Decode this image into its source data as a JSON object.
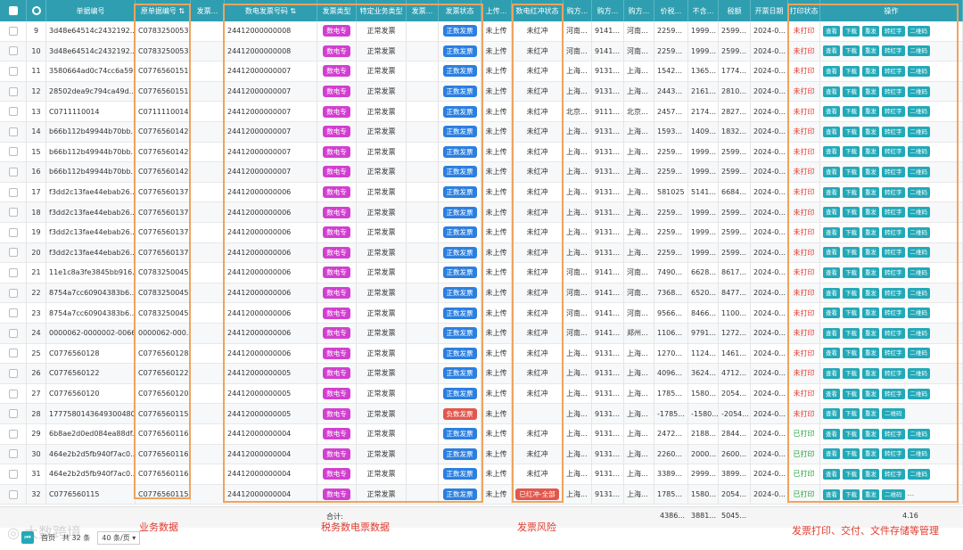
{
  "columns": {
    "row_no": "",
    "bill_no": "单据编号",
    "src_bill_no": "原单据编号",
    "issuer": "发票...",
    "invoice_no": "数电发票号码",
    "invoice_type": "发票类型",
    "biz_type": "特定业务类型",
    "invoice_x": "发票...",
    "invoice_status": "发票状态",
    "upload": "上传...",
    "red_status": "数电红冲状态",
    "buyer1": "购方...",
    "buyer2": "购方...",
    "buyer3": "购方...",
    "total": "价税...",
    "excl": "不含...",
    "tax": "税额",
    "date": "开票日期",
    "print_status": "打印状态",
    "ops": "操作"
  },
  "op_labels": {
    "view": "查看",
    "download": "下载",
    "resend": "重发",
    "to_red": "转红字",
    "qrcode": "二维码",
    "more": "..."
  },
  "rows": [
    {
      "n": "9",
      "bill": "3d48e64514c2432192...",
      "src": "C0783250053",
      "inv": "24412000000008",
      "itype": "数电专",
      "biz": "正常发票",
      "status": "正数发票",
      "stype": "blue",
      "upload": "未上传",
      "red": "未红冲",
      "rtype": "",
      "b1": "河南...",
      "b2": "9141...",
      "b3": "河南...",
      "total": "2259...",
      "excl": "1999...",
      "tax": "2599...",
      "date": "2024-0...",
      "print": "未打印",
      "ptype": "red",
      "ops": [
        "view",
        "download",
        "resend",
        "to_red",
        "qrcode"
      ]
    },
    {
      "n": "10",
      "bill": "3d48e64514c2432192...",
      "src": "C0783250053",
      "inv": "24412000000008",
      "itype": "数电专",
      "biz": "正常发票",
      "status": "正数发票",
      "stype": "blue",
      "upload": "未上传",
      "red": "未红冲",
      "rtype": "",
      "b1": "河南...",
      "b2": "9141...",
      "b3": "河南...",
      "total": "2259...",
      "excl": "1999...",
      "tax": "2599...",
      "date": "2024-0...",
      "print": "未打印",
      "ptype": "red",
      "ops": [
        "view",
        "download",
        "resend",
        "to_red",
        "qrcode"
      ]
    },
    {
      "n": "11",
      "bill": "3580664ad0c74cc6a59...",
      "src": "C0776560151",
      "inv": "24412000000007",
      "itype": "数电专",
      "biz": "正常发票",
      "status": "正数发票",
      "stype": "blue",
      "upload": "未上传",
      "red": "未红冲",
      "rtype": "",
      "b1": "上海...",
      "b2": "9131...",
      "b3": "上海...",
      "total": "1542...",
      "excl": "1365...",
      "tax": "1774...",
      "date": "2024-0...",
      "print": "未打印",
      "ptype": "red",
      "ops": [
        "view",
        "download",
        "resend",
        "to_red",
        "qrcode"
      ]
    },
    {
      "n": "12",
      "bill": "28502dea9c794ca49d...",
      "src": "C0776560151",
      "inv": "24412000000007",
      "itype": "数电专",
      "biz": "正常发票",
      "status": "正数发票",
      "stype": "blue",
      "upload": "未上传",
      "red": "未红冲",
      "rtype": "",
      "b1": "上海...",
      "b2": "9131...",
      "b3": "上海...",
      "total": "2443...",
      "excl": "2161...",
      "tax": "2810...",
      "date": "2024-0...",
      "print": "未打印",
      "ptype": "red",
      "ops": [
        "view",
        "download",
        "resend",
        "to_red",
        "qrcode"
      ]
    },
    {
      "n": "13",
      "bill": "C0711110014",
      "src": "C0711110014",
      "inv": "24412000000007",
      "itype": "数电专",
      "biz": "正常发票",
      "status": "正数发票",
      "stype": "blue",
      "upload": "未上传",
      "red": "未红冲",
      "rtype": "",
      "b1": "北京...",
      "b2": "9111...",
      "b3": "北京...",
      "total": "2457...",
      "excl": "2174...",
      "tax": "2827...",
      "date": "2024-0...",
      "print": "未打印",
      "ptype": "red",
      "ops": [
        "view",
        "download",
        "resend",
        "to_red",
        "qrcode"
      ]
    },
    {
      "n": "14",
      "bill": "b66b112b49944b70bb...",
      "src": "C0776560142",
      "inv": "24412000000007",
      "itype": "数电专",
      "biz": "正常发票",
      "status": "正数发票",
      "stype": "blue",
      "upload": "未上传",
      "red": "未红冲",
      "rtype": "",
      "b1": "上海...",
      "b2": "9131...",
      "b3": "上海...",
      "total": "1593...",
      "excl": "1409...",
      "tax": "1832...",
      "date": "2024-0...",
      "print": "未打印",
      "ptype": "red",
      "ops": [
        "view",
        "download",
        "resend",
        "to_red",
        "qrcode"
      ]
    },
    {
      "n": "15",
      "bill": "b66b112b49944b70bb...",
      "src": "C0776560142",
      "inv": "24412000000007",
      "itype": "数电专",
      "biz": "正常发票",
      "status": "正数发票",
      "stype": "blue",
      "upload": "未上传",
      "red": "未红冲",
      "rtype": "",
      "b1": "上海...",
      "b2": "9131...",
      "b3": "上海...",
      "total": "2259...",
      "excl": "1999...",
      "tax": "2599...",
      "date": "2024-0...",
      "print": "未打印",
      "ptype": "red",
      "ops": [
        "view",
        "download",
        "resend",
        "to_red",
        "qrcode"
      ]
    },
    {
      "n": "16",
      "bill": "b66b112b49944b70bb...",
      "src": "C0776560142",
      "inv": "24412000000007",
      "itype": "数电专",
      "biz": "正常发票",
      "status": "正数发票",
      "stype": "blue",
      "upload": "未上传",
      "red": "未红冲",
      "rtype": "",
      "b1": "上海...",
      "b2": "9131...",
      "b3": "上海...",
      "total": "2259...",
      "excl": "1999...",
      "tax": "2599...",
      "date": "2024-0...",
      "print": "未打印",
      "ptype": "red",
      "ops": [
        "view",
        "download",
        "resend",
        "to_red",
        "qrcode"
      ]
    },
    {
      "n": "17",
      "bill": "f3dd2c13fae44ebab26...",
      "src": "C0776560137",
      "inv": "24412000000006",
      "itype": "数电专",
      "biz": "正常发票",
      "status": "正数发票",
      "stype": "blue",
      "upload": "未上传",
      "red": "未红冲",
      "rtype": "",
      "b1": "上海...",
      "b2": "9131...",
      "b3": "上海...",
      "total": "581025",
      "excl": "5141...",
      "tax": "6684...",
      "date": "2024-0...",
      "print": "未打印",
      "ptype": "red",
      "ops": [
        "view",
        "download",
        "resend",
        "to_red",
        "qrcode"
      ]
    },
    {
      "n": "18",
      "bill": "f3dd2c13fae44ebab26...",
      "src": "C0776560137",
      "inv": "24412000000006",
      "itype": "数电专",
      "biz": "正常发票",
      "status": "正数发票",
      "stype": "blue",
      "upload": "未上传",
      "red": "未红冲",
      "rtype": "",
      "b1": "上海...",
      "b2": "9131...",
      "b3": "上海...",
      "total": "2259...",
      "excl": "1999...",
      "tax": "2599...",
      "date": "2024-0...",
      "print": "未打印",
      "ptype": "red",
      "ops": [
        "view",
        "download",
        "resend",
        "to_red",
        "qrcode"
      ]
    },
    {
      "n": "19",
      "bill": "f3dd2c13fae44ebab26...",
      "src": "C0776560137",
      "inv": "24412000000006",
      "itype": "数电专",
      "biz": "正常发票",
      "status": "正数发票",
      "stype": "blue",
      "upload": "未上传",
      "red": "未红冲",
      "rtype": "",
      "b1": "上海...",
      "b2": "9131...",
      "b3": "上海...",
      "total": "2259...",
      "excl": "1999...",
      "tax": "2599...",
      "date": "2024-0...",
      "print": "未打印",
      "ptype": "red",
      "ops": [
        "view",
        "download",
        "resend",
        "to_red",
        "qrcode"
      ]
    },
    {
      "n": "20",
      "bill": "f3dd2c13fae44ebab26...",
      "src": "C0776560137",
      "inv": "24412000000006",
      "itype": "数电专",
      "biz": "正常发票",
      "status": "正数发票",
      "stype": "blue",
      "upload": "未上传",
      "red": "未红冲",
      "rtype": "",
      "b1": "上海...",
      "b2": "9131...",
      "b3": "上海...",
      "total": "2259...",
      "excl": "1999...",
      "tax": "2599...",
      "date": "2024-0...",
      "print": "未打印",
      "ptype": "red",
      "ops": [
        "view",
        "download",
        "resend",
        "to_red",
        "qrcode"
      ]
    },
    {
      "n": "21",
      "bill": "11e1c8a3fe3845bb916...",
      "src": "C0783250045",
      "inv": "24412000000006",
      "itype": "数电专",
      "biz": "正常发票",
      "status": "正数发票",
      "stype": "blue",
      "upload": "未上传",
      "red": "未红冲",
      "rtype": "",
      "b1": "河南...",
      "b2": "9141...",
      "b3": "河南...",
      "total": "7490...",
      "excl": "6628...",
      "tax": "8617...",
      "date": "2024-0...",
      "print": "未打印",
      "ptype": "red",
      "ops": [
        "view",
        "download",
        "resend",
        "to_red",
        "qrcode"
      ]
    },
    {
      "n": "22",
      "bill": "8754a7cc60904383b6...",
      "src": "C0783250045",
      "inv": "24412000000006",
      "itype": "数电专",
      "biz": "正常发票",
      "status": "正数发票",
      "stype": "blue",
      "upload": "未上传",
      "red": "未红冲",
      "rtype": "",
      "b1": "河南...",
      "b2": "9141...",
      "b3": "河南...",
      "total": "7368...",
      "excl": "6520...",
      "tax": "8477...",
      "date": "2024-0...",
      "print": "未打印",
      "ptype": "red",
      "ops": [
        "view",
        "download",
        "resend",
        "to_red",
        "qrcode"
      ]
    },
    {
      "n": "23",
      "bill": "8754a7cc60904383b6...",
      "src": "C0783250045",
      "inv": "24412000000006",
      "itype": "数电专",
      "biz": "正常发票",
      "status": "正数发票",
      "stype": "blue",
      "upload": "未上传",
      "red": "未红冲",
      "rtype": "",
      "b1": "河南...",
      "b2": "9141...",
      "b3": "河南...",
      "total": "9566...",
      "excl": "8466...",
      "tax": "1100...",
      "date": "2024-0...",
      "print": "未打印",
      "ptype": "red",
      "ops": [
        "view",
        "download",
        "resend",
        "to_red",
        "qrcode"
      ]
    },
    {
      "n": "24",
      "bill": "0000062-0000002-0066",
      "src": "0000062-000...",
      "inv": "24412000000006",
      "itype": "数电专",
      "biz": "正常发票",
      "status": "正数发票",
      "stype": "blue",
      "upload": "未上传",
      "red": "未红冲",
      "rtype": "",
      "b1": "河南...",
      "b2": "9141...",
      "b3": "郑州...",
      "total": "1106...",
      "excl": "9791...",
      "tax": "1272...",
      "date": "2024-0...",
      "print": "未打印",
      "ptype": "red",
      "ops": [
        "view",
        "download",
        "resend",
        "to_red",
        "qrcode"
      ]
    },
    {
      "n": "25",
      "bill": "C0776560128",
      "src": "C0776560128",
      "inv": "24412000000006",
      "itype": "数电专",
      "biz": "正常发票",
      "status": "正数发票",
      "stype": "blue",
      "upload": "未上传",
      "red": "未红冲",
      "rtype": "",
      "b1": "上海...",
      "b2": "9131...",
      "b3": "上海...",
      "total": "1270...",
      "excl": "1124...",
      "tax": "1461...",
      "date": "2024-0...",
      "print": "未打印",
      "ptype": "red",
      "ops": [
        "view",
        "download",
        "resend",
        "to_red",
        "qrcode"
      ]
    },
    {
      "n": "26",
      "bill": "C0776560122",
      "src": "C0776560122",
      "inv": "24412000000005",
      "itype": "数电专",
      "biz": "正常发票",
      "status": "正数发票",
      "stype": "blue",
      "upload": "未上传",
      "red": "未红冲",
      "rtype": "",
      "b1": "上海...",
      "b2": "9131...",
      "b3": "上海...",
      "total": "4096...",
      "excl": "3624...",
      "tax": "4712...",
      "date": "2024-0...",
      "print": "未打印",
      "ptype": "red",
      "ops": [
        "view",
        "download",
        "resend",
        "to_red",
        "qrcode"
      ]
    },
    {
      "n": "27",
      "bill": "C0776560120",
      "src": "C0776560120",
      "inv": "24412000000005",
      "itype": "数电专",
      "biz": "正常发票",
      "status": "正数发票",
      "stype": "blue",
      "upload": "未上传",
      "red": "未红冲",
      "rtype": "",
      "b1": "上海...",
      "b2": "9131...",
      "b3": "上海...",
      "total": "1785...",
      "excl": "1580...",
      "tax": "2054...",
      "date": "2024-0...",
      "print": "未打印",
      "ptype": "red",
      "ops": [
        "view",
        "download",
        "resend",
        "to_red",
        "qrcode"
      ]
    },
    {
      "n": "28",
      "bill": "1777580143649300480",
      "src": "C0776560115",
      "inv": "24412000000005",
      "itype": "数电专",
      "biz": "正常发票",
      "status": "负数发票",
      "stype": "red",
      "upload": "未上传",
      "red": "",
      "rtype": "",
      "b1": "上海...",
      "b2": "9131...",
      "b3": "上海...",
      "total": "-1785...",
      "excl": "-1580...",
      "tax": "-2054...",
      "date": "2024-0...",
      "print": "未打印",
      "ptype": "red",
      "ops": [
        "view",
        "download",
        "resend",
        "qrcode"
      ]
    },
    {
      "n": "29",
      "bill": "6b8ae2d0ed084ea88df...",
      "src": "C0776560116",
      "inv": "24412000000004",
      "itype": "数电专",
      "biz": "正常发票",
      "status": "正数发票",
      "stype": "blue",
      "upload": "未上传",
      "red": "未红冲",
      "rtype": "",
      "b1": "上海...",
      "b2": "9131...",
      "b3": "上海...",
      "total": "2472...",
      "excl": "2188...",
      "tax": "2844...",
      "date": "2024-0...",
      "print": "已打印",
      "ptype": "green",
      "ops": [
        "view",
        "download",
        "resend",
        "to_red",
        "qrcode"
      ]
    },
    {
      "n": "30",
      "bill": "464e2b2d5fb940f7ac0...",
      "src": "C0776560116",
      "inv": "24412000000004",
      "itype": "数电专",
      "biz": "正常发票",
      "status": "正数发票",
      "stype": "blue",
      "upload": "未上传",
      "red": "未红冲",
      "rtype": "",
      "b1": "上海...",
      "b2": "9131...",
      "b3": "上海...",
      "total": "2260...",
      "excl": "2000...",
      "tax": "2600...",
      "date": "2024-0...",
      "print": "已打印",
      "ptype": "green",
      "ops": [
        "view",
        "download",
        "resend",
        "to_red",
        "qrcode"
      ]
    },
    {
      "n": "31",
      "bill": "464e2b2d5fb940f7ac0...",
      "src": "C0776560116",
      "inv": "24412000000004",
      "itype": "数电专",
      "biz": "正常发票",
      "status": "正数发票",
      "stype": "blue",
      "upload": "未上传",
      "red": "未红冲",
      "rtype": "",
      "b1": "上海...",
      "b2": "9131...",
      "b3": "上海...",
      "total": "3389...",
      "excl": "2999...",
      "tax": "3899...",
      "date": "2024-0...",
      "print": "已打印",
      "ptype": "green",
      "ops": [
        "view",
        "download",
        "resend",
        "to_red",
        "qrcode"
      ]
    },
    {
      "n": "32",
      "bill": "C0776560115",
      "src": "C0776560115",
      "inv": "24412000000004",
      "itype": "数电专",
      "biz": "正常发票",
      "status": "正数发票",
      "stype": "blue",
      "upload": "未上传",
      "red": "已红冲-全部",
      "rtype": "tag",
      "b1": "上海...",
      "b2": "9131...",
      "b3": "上海...",
      "total": "1785...",
      "excl": "1580...",
      "tax": "2054...",
      "date": "2024-0...",
      "print": "已打印",
      "ptype": "green",
      "ops": [
        "view",
        "download",
        "resend",
        "qrcode",
        "more"
      ]
    }
  ],
  "footer": {
    "sum_label": "合计:",
    "sum_total": "4386...",
    "sum_excl": "3881...",
    "sum_tax": "5045...",
    "sum_right": "4.16"
  },
  "pager": {
    "total": "共 32 条",
    "page_size": "40 条/页",
    "first": "首页"
  },
  "annotations": {
    "biz": "业务数据",
    "tax": "税务数电票数据",
    "risk": "发票风险",
    "ops": "发票打印、交付、文件存储等管理"
  },
  "watermark": "大数跨境"
}
